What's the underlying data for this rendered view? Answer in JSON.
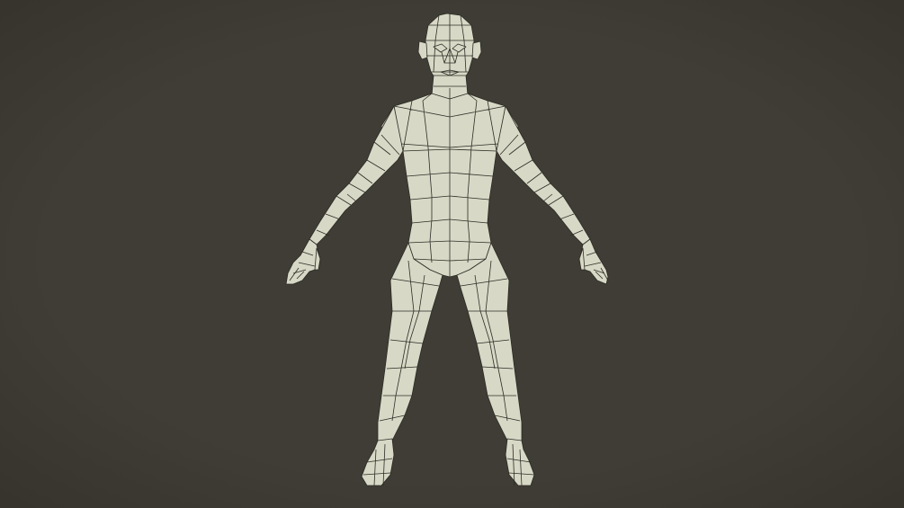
{
  "viewport": {
    "background_color": "#3f3d35",
    "vignette_color": "#2f2d26"
  },
  "model": {
    "surface_color": "#d8d8c6",
    "edge_color": "#2c2c26",
    "shadow_color": "#bcbca8",
    "display_mode": "wireframe-on-shaded",
    "pose": "A-pose"
  }
}
